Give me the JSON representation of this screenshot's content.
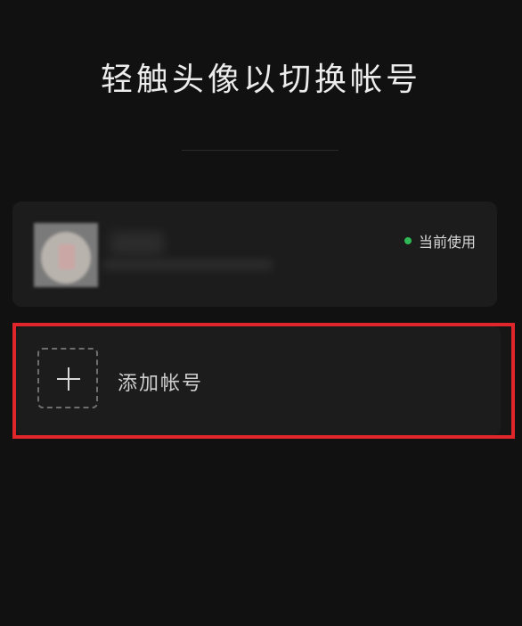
{
  "header": {
    "title": "轻触头像以切换帐号"
  },
  "current_account": {
    "status_label": "当前使用",
    "status_color": "#2fb855"
  },
  "add_account": {
    "label": "添加帐号",
    "icon": "plus-icon",
    "highlight_color": "#e1262b"
  }
}
